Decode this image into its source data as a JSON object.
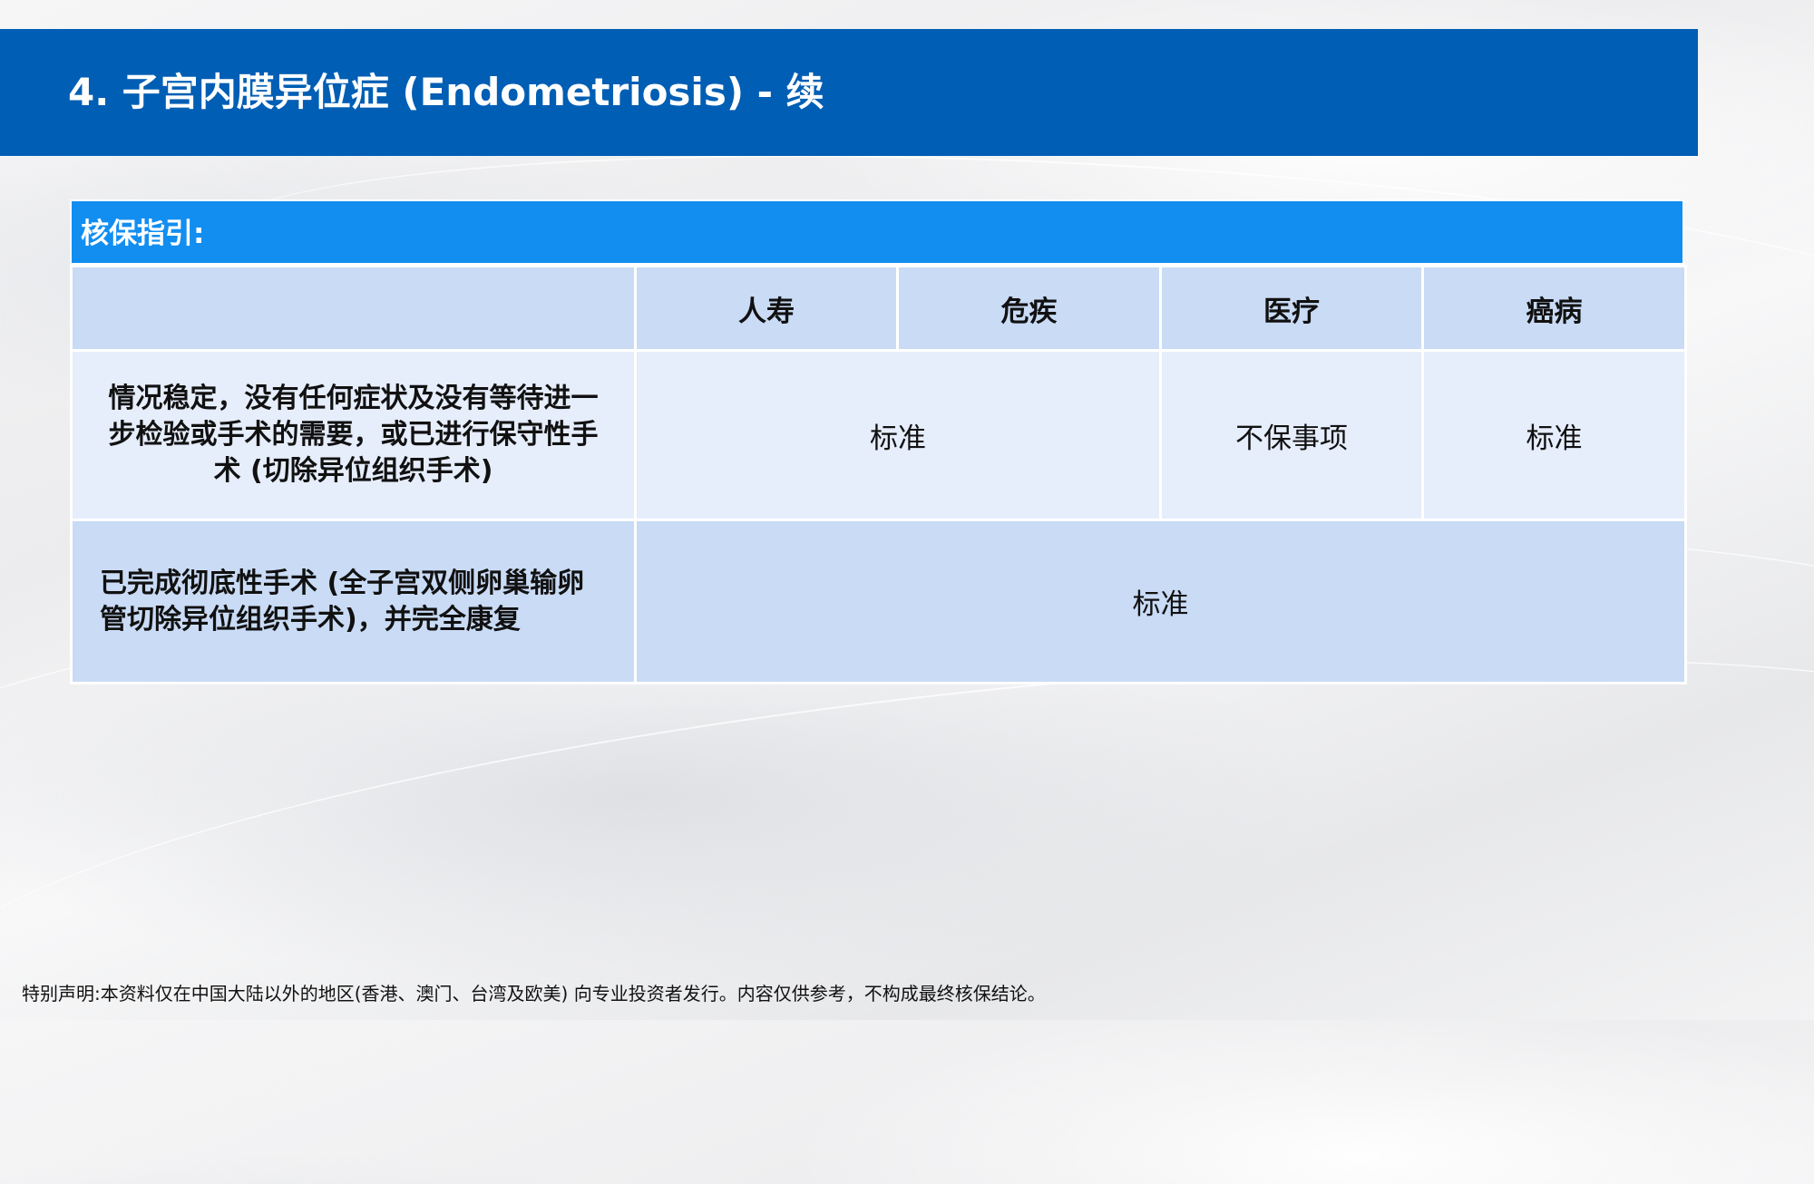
{
  "slide": {
    "title": "4. 子宫内膜异位症 (Endometriosis) - 续"
  },
  "guide": {
    "section_label": "核保指引:",
    "columns": [
      "",
      "人寿",
      "危疾",
      "医疗",
      "癌病"
    ],
    "rows": [
      {
        "condition": "情况稳定，没有任何症状及没有等待进一步检验或手术的需要，或已进行保守性手术 (切除异位组织手术)",
        "life_ci": "标准",
        "medical": "不保事项",
        "cancer": "标准"
      },
      {
        "condition": "已完成彻底性手术 (全子宫双侧卵巢输卵管切除异位组织手术)，并完全康复",
        "all": "标准"
      }
    ]
  },
  "footer": {
    "disclaimer": "特别声明:本资料仅在中国大陆以外的地区(香港、澳门、台湾及欧美) 向专业投资者发行。内容仅供参考，不构成最终核保结论。"
  }
}
